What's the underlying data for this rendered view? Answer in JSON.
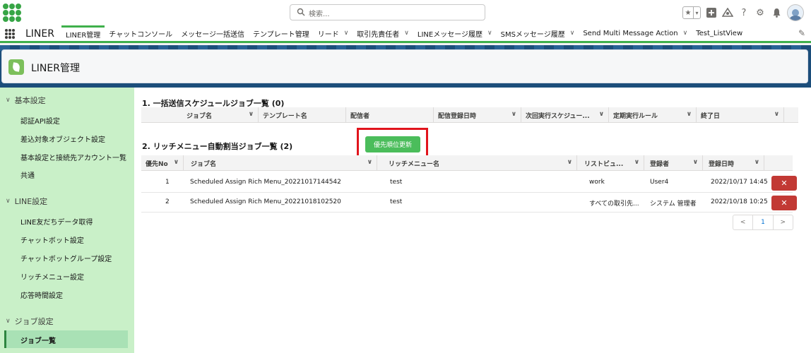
{
  "header": {
    "search_placeholder": "検索...",
    "icons": [
      "favorites-star-icon",
      "add-icon",
      "trailhead-icon",
      "help-icon",
      "settings-icon",
      "notification-bell-icon",
      "avatar"
    ]
  },
  "nav": {
    "app_name": "LINER",
    "items": [
      {
        "label": "LINER管理",
        "active": true,
        "has_menu": false
      },
      {
        "label": "チャットコンソール",
        "has_menu": false
      },
      {
        "label": "メッセージ一括送信",
        "has_menu": false
      },
      {
        "label": "テンプレート管理",
        "has_menu": false
      },
      {
        "label": "リード",
        "has_menu": true
      },
      {
        "label": "取引先責任者",
        "has_menu": true
      },
      {
        "label": "LINEメッセージ履歴",
        "has_menu": true
      },
      {
        "label": "SMSメッセージ履歴",
        "has_menu": true
      },
      {
        "label": "Send Multi Message Action",
        "has_menu": true
      },
      {
        "label": "Test_ListView",
        "has_menu": false
      }
    ],
    "accent": "#3fb04c"
  },
  "page": {
    "title": "LINER管理"
  },
  "sidebar": {
    "sections": [
      {
        "label": "基本設定",
        "items": [
          "認証API設定",
          "差込対象オブジェクト設定",
          "基本設定と接続先アカウント一覧",
          "共通"
        ]
      },
      {
        "label": "LINE設定",
        "items": [
          "LINE友だちデータ取得",
          "チャットボット設定",
          "チャットボットグループ設定",
          "リッチメニュー設定",
          "応答時間設定"
        ]
      },
      {
        "label": "ジョブ設定",
        "items": [
          "ジョブ一覧"
        ]
      }
    ],
    "active_item": "ジョブ一覧"
  },
  "schedule_section": {
    "title": "1. 一括送信スケジュールジョブ一覧 (0)",
    "columns": [
      "ジョブ名",
      "テンプレート名",
      "配信者",
      "配信登録日時",
      "次回実行スケジュー...",
      "定期実行ルール",
      "終了日"
    ]
  },
  "richmenu_section": {
    "title": "2. リッチメニュー自動割当ジョブ一覧 (2)",
    "priority_button": "優先順位更新",
    "columns": [
      "優先No",
      "ジョブ名",
      "リッチメニュー名",
      "リストビュ...",
      "登録者",
      "登録日時"
    ],
    "rows": [
      {
        "no": "1",
        "job": "Scheduled Assign Rich Menu_20221017144542",
        "menu": "test",
        "listview": "work",
        "registrant": "User4",
        "date": "2022/10/17 14:45"
      },
      {
        "no": "2",
        "job": "Scheduled Assign Rich Menu_20221018102520",
        "menu": "test",
        "listview": "すべての取引先...",
        "registrant": "システム 管理者",
        "date": "2022/10/18 10:25"
      }
    ]
  },
  "pager": {
    "prev": "<",
    "page": "1",
    "next": ">"
  }
}
